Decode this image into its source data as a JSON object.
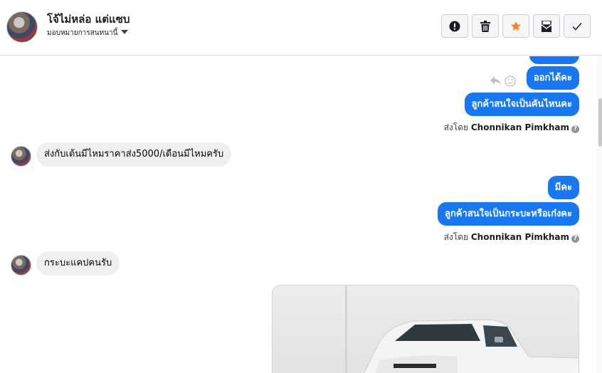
{
  "header": {
    "title": "โจ้ไม่หล่อ แต่แซบ",
    "assign_label": "มอบหมายการสนทนานี้",
    "buttons": [
      {
        "name": "mark-spam-button",
        "icon": "exclamation-icon"
      },
      {
        "name": "delete-button",
        "icon": "trash-icon"
      },
      {
        "name": "star-button",
        "icon": "star-icon",
        "color": "#f5821f"
      },
      {
        "name": "mark-unread-button",
        "icon": "envelope-icon"
      },
      {
        "name": "mark-done-button",
        "icon": "checkmark-icon"
      }
    ]
  },
  "messages": {
    "out1": "ออกได้คะ",
    "out2": "ลูกค้าสนใจเป็นคันไหนคะ",
    "sent_by_1_prefix": "ส่งโดย",
    "sent_by_1_name": "Chonnikan Pimkham",
    "in1": "ส่งกับเต้นมีไหมราคาส่ง5000/เดือนมีไหมครับ",
    "out3": "มีคะ",
    "out4": "ลูกค้าสนใจเป็นกระบะหรือเก๋งคะ",
    "sent_by_2_prefix": "ส่งโดย",
    "sent_by_2_name": "Chonnikan Pimkham",
    "in2": "กระบะแคปคนรับ"
  },
  "colors": {
    "accent": "#1877f2",
    "incoming_bubble": "#f0f0f0",
    "star": "#f5821f"
  }
}
